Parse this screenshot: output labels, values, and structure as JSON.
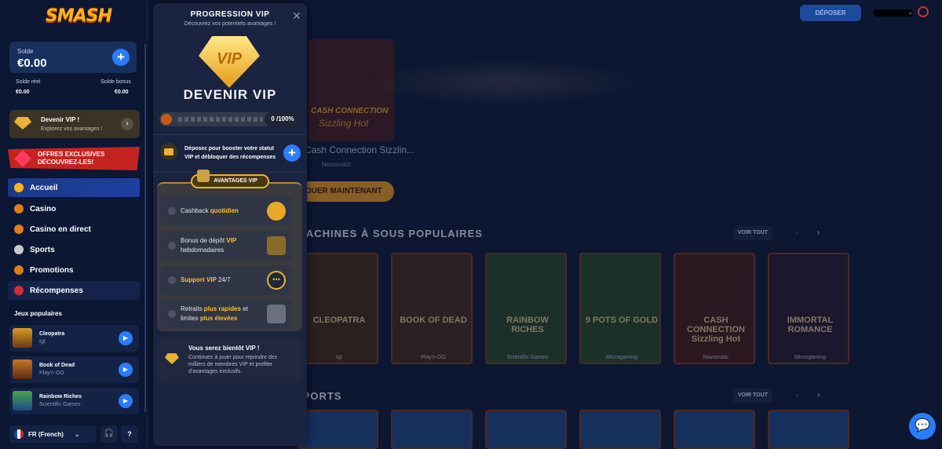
{
  "sidebar": {
    "logo": "SMASH",
    "balance_label": "Solde",
    "balance_amount": "€0.00",
    "real_label": "Solde réel",
    "real_value": "€0.00",
    "bonus_label": "Solde bonus",
    "bonus_value": "€0.00",
    "vip_title": "Devenir VIP !",
    "vip_sub": "Explorez vos avantages !",
    "offers_line1": "OFFRES EXCLUSIVES",
    "offers_line2": "DÉCOUVREZ-LES!",
    "nav": [
      "Accueil",
      "Casino",
      "Casino en direct",
      "Sports",
      "Promotions",
      "Récompenses"
    ],
    "popular_title": "Jeux populaires",
    "games": [
      {
        "name": "Cleopatra",
        "provider": "Igt"
      },
      {
        "name": "Book of Dead",
        "provider": "Play'n GO"
      },
      {
        "name": "Rainbow Riches",
        "provider": "Scientific Games"
      }
    ],
    "language": "FR (French)"
  },
  "header": {
    "deposit": "DÉPOSER"
  },
  "main": {
    "banner_title": "Cash Connection Sizzlin...",
    "banner_provider": "Novomatic",
    "play_now": "JOUER MAINTENANT",
    "section1": "MACHINES À SOUS POPULAIRES",
    "section2": "SPORTS",
    "voir_tout": "VOIR TOUT",
    "tiles": [
      {
        "title": "CLEOPATRA",
        "provider": "Igt"
      },
      {
        "title": "BOOK OF DEAD",
        "provider": "Play'n GO"
      },
      {
        "title": "RAINBOW RICHES",
        "provider": "Scientific Games"
      },
      {
        "title": "9 POTS OF GOLD",
        "provider": "Microgaming"
      },
      {
        "title": "CASH CONNECTION Sizzling Hot",
        "provider": "Novomatic"
      },
      {
        "title": "IMMORTAL ROMANCE",
        "provider": "Microgaming"
      }
    ]
  },
  "panel": {
    "title": "PROGRESSION VIP",
    "subtitle": "Découvrez vos potentiels avantages !",
    "badge": "VIP",
    "heading": "DEVENIR VIP",
    "progress": "0 /100%",
    "progress_value": 0,
    "deposit_text": "Déposez pour booster votre statut VIP et débloquer des récompenses",
    "advantages_label": "AVANTAGES VIP",
    "rows": [
      {
        "a": "Cashback ",
        "b": "quotidien",
        "c": ""
      },
      {
        "a": "Bonus de dépôt ",
        "b": "VIP",
        "c": " hebdomadaires"
      },
      {
        "a": "",
        "b": "Support VIP",
        "c": " 24/7"
      },
      {
        "a": "Retraits ",
        "b": "plus rapides",
        "c": " et limites ",
        "d": "plus élevées"
      }
    ],
    "soon_title": "Vous serez bientôt VIP !",
    "soon_text": "Continuez à jouer pour rejoindre des milliers de membres VIP et profiter d'avantages exclusifs."
  },
  "colors": {
    "accent": "#2b7cff",
    "gold": "#ffbe2e",
    "sidebar": "#0b1733",
    "panel": "#1a2340"
  }
}
